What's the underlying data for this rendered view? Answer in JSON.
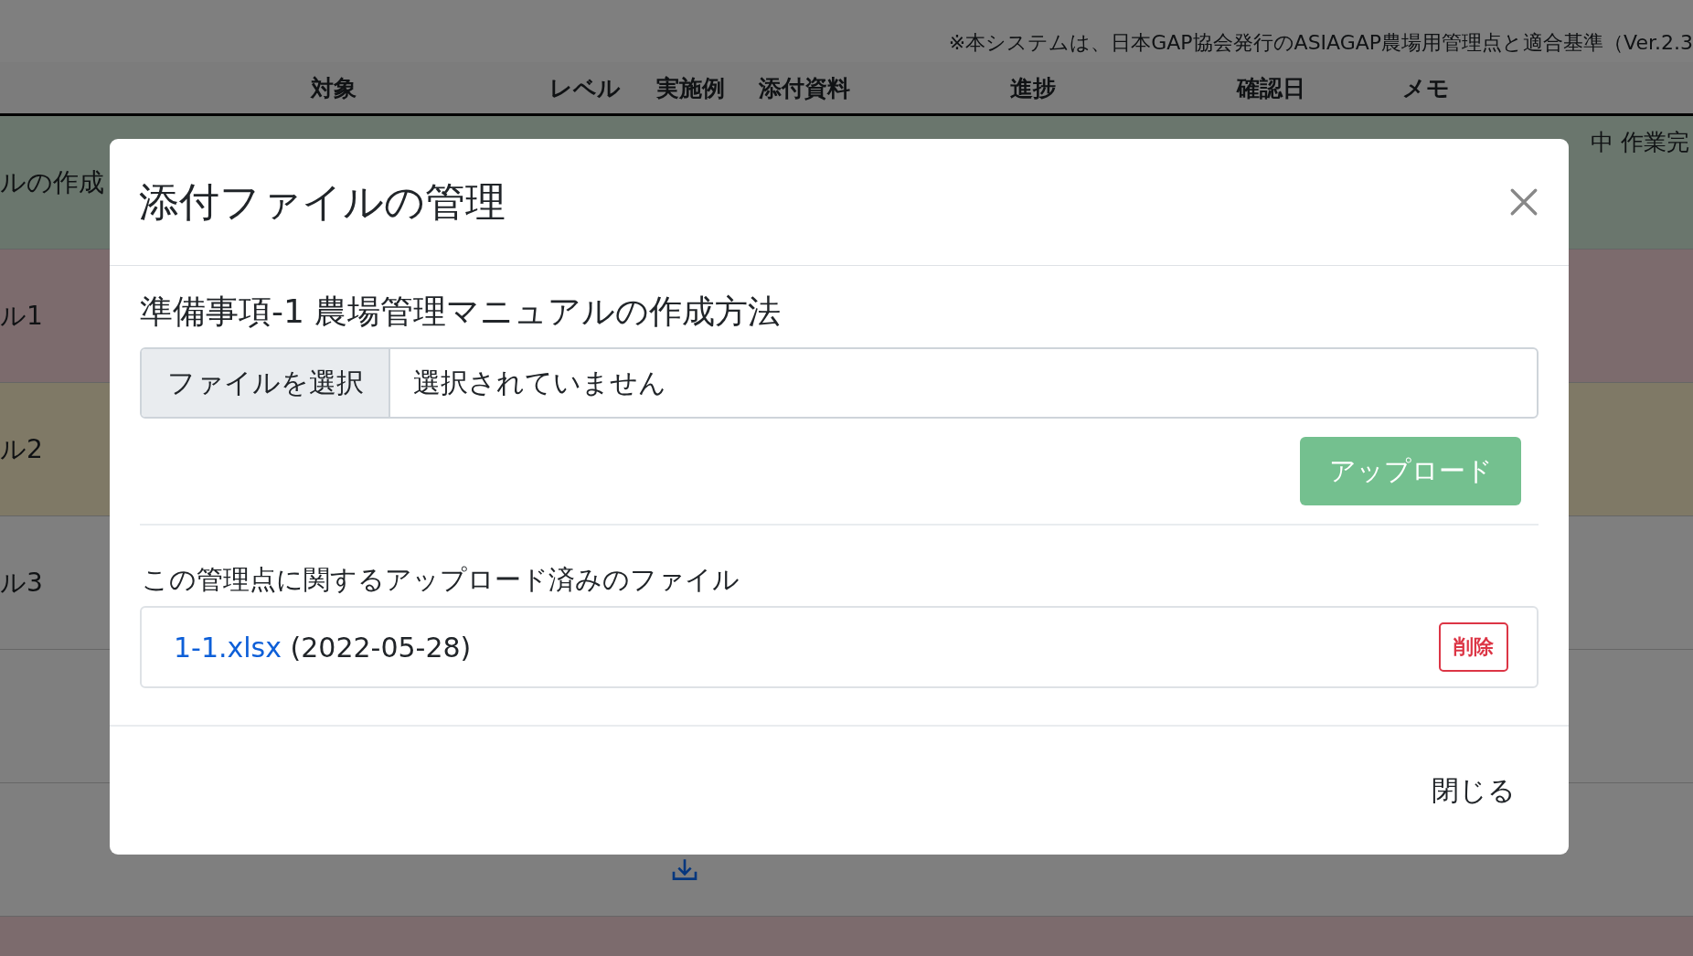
{
  "notice": "※本システムは、日本GAP協会発行のASIAGAP農場用管理点と適合基準（Ver.2.3",
  "table": {
    "columns": [
      {
        "label": "対象",
        "kind": "target"
      },
      {
        "label": "レベル",
        "kind": "level"
      },
      {
        "label": "実施例",
        "kind": "example"
      },
      {
        "label": "添付資料",
        "kind": "attach"
      },
      {
        "label": "進捗",
        "kind": "progress"
      },
      {
        "label": "確認日",
        "kind": "date"
      },
      {
        "label": "メモ",
        "kind": "memo"
      }
    ],
    "rows": [
      {
        "kind": "success",
        "text": "ルの作成",
        "memo": "中 作業完"
      },
      {
        "kind": "danger",
        "text": "ル1"
      },
      {
        "kind": "warning",
        "text": "ル2"
      },
      {
        "kind": "plain",
        "text": "ル3"
      },
      {
        "kind": "plain"
      },
      {
        "kind": "plain",
        "download": true
      },
      {
        "kind": "danger"
      }
    ]
  },
  "modal": {
    "title": "添付ファイルの管理",
    "subtitle": "準備事項-1 農場管理マニュアルの作成方法",
    "file_button": "ファイルを選択",
    "file_status": "選択されていません",
    "upload": {
      "label": "アップロード",
      "disabled": true
    },
    "files_label": "この管理点に関するアップロード済みのファイル",
    "files": [
      {
        "name": "1-1.xlsx",
        "date": "(2022-05-28)",
        "delete": "削除"
      }
    ],
    "close": "閉じる"
  }
}
